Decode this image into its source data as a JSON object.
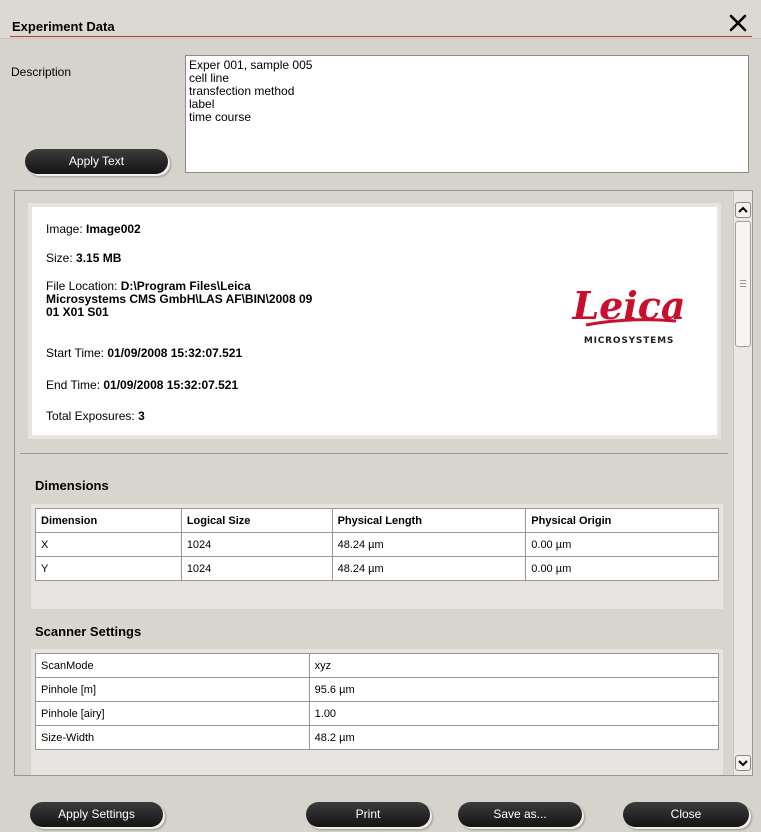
{
  "window": {
    "title": "Experiment Data"
  },
  "description": {
    "label": "Description",
    "text": "Exper 001, sample 005\ncell line\ntransfection method\nlabel\ntime course",
    "apply_label": "Apply Text"
  },
  "info": {
    "image_label": "Image:",
    "image_value": "Image002",
    "size_label": "Size:",
    "size_value": "3.15 MB",
    "file_label": "File Location:",
    "file_value": "D:\\Program Files\\Leica Microsystems CMS GmbH\\LAS AF\\BIN\\2008 09 01 X01 S01",
    "start_label": "Start Time:",
    "start_value": "01/09/2008 15:32:07.521",
    "end_label": "End Time:",
    "end_value": "01/09/2008 15:32:07.521",
    "exposures_label": "Total Exposures:",
    "exposures_value": "3",
    "logo_text": "Leica",
    "logo_sub": "MICROSYSTEMS"
  },
  "dimensions": {
    "title": "Dimensions",
    "headers": [
      "Dimension",
      "Logical Size",
      "Physical Length",
      "Physical Origin"
    ],
    "rows": [
      [
        "X",
        "1024",
        "48.24 µm",
        "0.00 µm"
      ],
      [
        "Y",
        "1024",
        "48.24 µm",
        "0.00 µm"
      ]
    ]
  },
  "scanner": {
    "title": "Scanner Settings",
    "rows": [
      [
        "ScanMode",
        "xyz"
      ],
      [
        "Pinhole [m]",
        "95.6  µm"
      ],
      [
        "Pinhole [airy]",
        "1.00"
      ],
      [
        "Size-Width",
        "48.2  µm"
      ]
    ]
  },
  "buttons": {
    "apply_settings": "Apply Settings",
    "print": "Print",
    "save_as": "Save as...",
    "close": "Close"
  },
  "colors": {
    "accent_line": "#b83a2a",
    "logo_red": "#c8102e",
    "button_dark": "#1e1e1e"
  }
}
